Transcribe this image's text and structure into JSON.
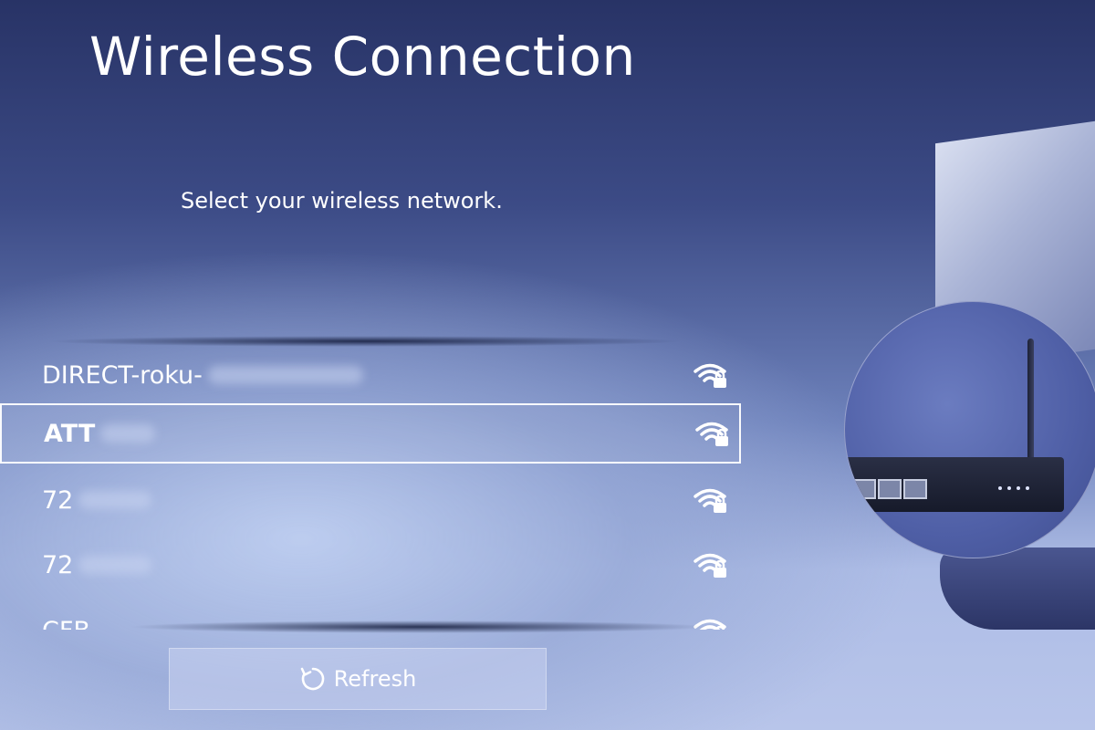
{
  "screen": {
    "title": "Wireless Connection",
    "subtitle": "Select your wireless network."
  },
  "networks": [
    {
      "name": "DIRECT-roku-",
      "secured": true,
      "selected": false,
      "signal_icon": "wifi-lock-icon"
    },
    {
      "name": "ATT",
      "secured": true,
      "selected": true,
      "signal_icon": "wifi-lock-icon"
    },
    {
      "name": "72",
      "secured": true,
      "selected": false,
      "signal_icon": "wifi-lock-icon"
    },
    {
      "name": "72",
      "secured": true,
      "selected": false,
      "signal_icon": "wifi-lock-icon"
    },
    {
      "name": "CFB",
      "secured": true,
      "selected": false,
      "signal_icon": "wifi-lock-icon"
    }
  ],
  "refresh_button": {
    "label": "Refresh",
    "icon": "refresh-icon"
  },
  "colors": {
    "text": "#ffffff",
    "background_top": "#283366",
    "background_bottom": "#b8c5ea",
    "selection_border": "#ffffff"
  }
}
